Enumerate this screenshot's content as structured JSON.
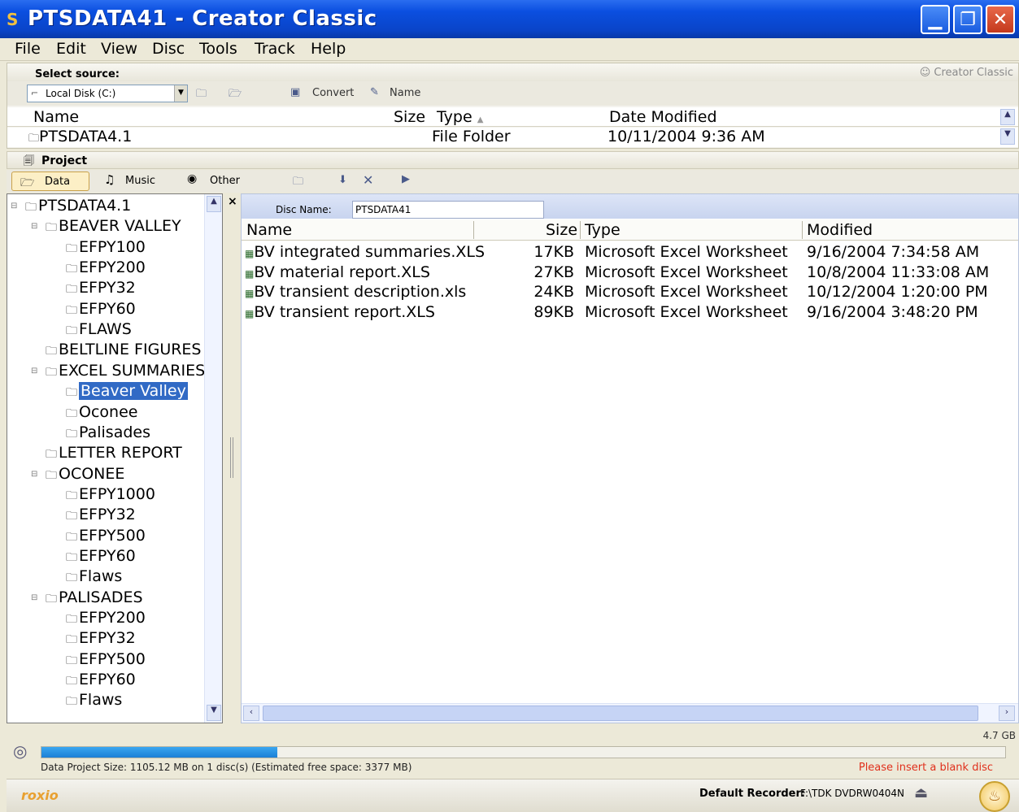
{
  "window": {
    "title": "PTSDATA41 - Creator Classic",
    "app_icon": "S"
  },
  "menu": [
    "File",
    "Edit",
    "View",
    "Disc",
    "Tools",
    "Track",
    "Help"
  ],
  "source": {
    "label": "Select source:",
    "brand": "Creator Classic",
    "drive": "Local Disk (C:)",
    "convert": "Convert",
    "name_btn": "Name",
    "columns": {
      "name": "Name",
      "size": "Size",
      "type": "Type",
      "date": "Date Modified"
    },
    "row": {
      "name": "PTSDATA4.1",
      "type": "File Folder",
      "date": "10/11/2004 9:36 AM"
    }
  },
  "project": {
    "label": "Project",
    "tabs": [
      "Data",
      "Music",
      "Other"
    ]
  },
  "tree": {
    "items": [
      {
        "label": "PTSDATA4.1",
        "level": 0,
        "expander": "−"
      },
      {
        "label": "BEAVER VALLEY",
        "level": 1,
        "expander": "−"
      },
      {
        "label": "EFPY100",
        "level": 2
      },
      {
        "label": "EFPY200",
        "level": 2
      },
      {
        "label": "EFPY32",
        "level": 2
      },
      {
        "label": "EFPY60",
        "level": 2
      },
      {
        "label": "FLAWS",
        "level": 2
      },
      {
        "label": "BELTLINE FIGURES",
        "level": 1
      },
      {
        "label": "EXCEL SUMMARIES",
        "level": 1,
        "expander": "−"
      },
      {
        "label": "Beaver Valley",
        "level": 2,
        "selected": true
      },
      {
        "label": "Oconee",
        "level": 2
      },
      {
        "label": "Palisades",
        "level": 2
      },
      {
        "label": "LETTER REPORT",
        "level": 1
      },
      {
        "label": "OCONEE",
        "level": 1,
        "expander": "−"
      },
      {
        "label": "EFPY1000",
        "level": 2
      },
      {
        "label": "EFPY32",
        "level": 2
      },
      {
        "label": "EFPY500",
        "level": 2
      },
      {
        "label": "EFPY60",
        "level": 2
      },
      {
        "label": "Flaws",
        "level": 2
      },
      {
        "label": "PALISADES",
        "level": 1,
        "expander": "−"
      },
      {
        "label": "EFPY200",
        "level": 2
      },
      {
        "label": "EFPY32",
        "level": 2
      },
      {
        "label": "EFPY500",
        "level": 2
      },
      {
        "label": "EFPY60",
        "level": 2
      },
      {
        "label": "Flaws",
        "level": 2
      }
    ]
  },
  "filepane": {
    "disc_name_label": "Disc Name:",
    "disc_name": "PTSDATA41",
    "columns": {
      "name": "Name",
      "size": "Size",
      "type": "Type",
      "modified": "Modified"
    },
    "rows": [
      {
        "name": "BV integrated summaries.XLS",
        "size": "17KB",
        "type": "Microsoft Excel Worksheet",
        "modified": "9/16/2004 7:34:58 AM"
      },
      {
        "name": "BV material report.XLS",
        "size": "27KB",
        "type": "Microsoft Excel Worksheet",
        "modified": "10/8/2004 11:33:08 AM"
      },
      {
        "name": "BV transient description.xls",
        "size": "24KB",
        "type": "Microsoft Excel Worksheet",
        "modified": "10/12/2004 1:20:00 PM"
      },
      {
        "name": "BV transient report.XLS",
        "size": "89KB",
        "type": "Microsoft Excel Worksheet",
        "modified": "9/16/2004 3:48:20 PM"
      }
    ]
  },
  "status": {
    "capacity": "4.7 GB",
    "progress_fraction": 0.245,
    "project_size": "Data Project Size: 1105.12 MB  on 1 disc(s)  (Estimated free space: 3377 MB)",
    "warning": "Please insert a blank disc",
    "warning_color": "#e0301c",
    "progress_color": "#1c7fd6"
  },
  "bottom": {
    "logo": "roxio",
    "recorder_label": "Default Recorder:",
    "recorder_value": "F:\\TDK DVDRW0404N"
  }
}
